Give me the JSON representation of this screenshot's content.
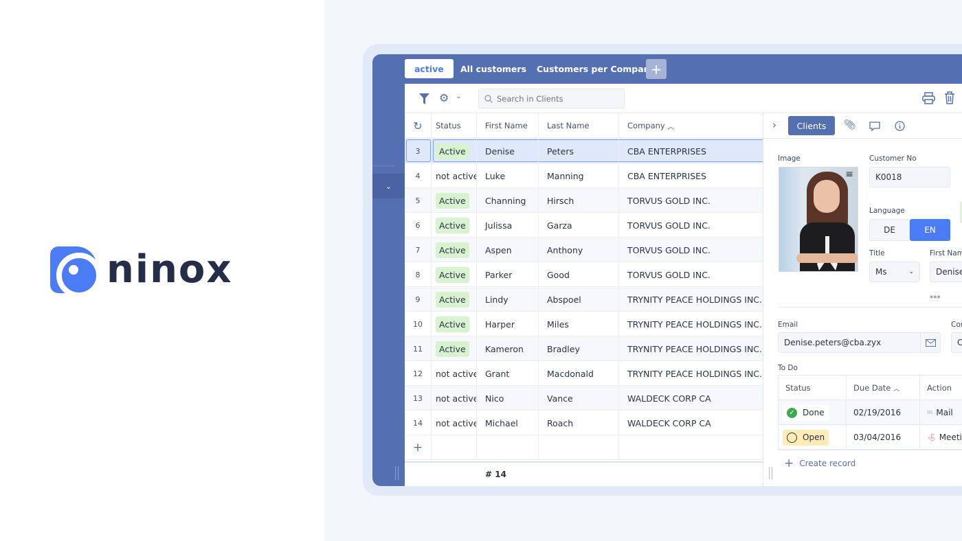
{
  "brand": {
    "name": "ninox",
    "color": "#4b7bf5"
  },
  "tabs": [
    {
      "label": "active",
      "active": true
    },
    {
      "label": "All customers"
    },
    {
      "label": "Customers per Company"
    }
  ],
  "toolbar": {
    "search_placeholder": "Search in Clients"
  },
  "table": {
    "headers": [
      "Status",
      "First Name",
      "Last Name",
      "Company"
    ],
    "sort_indicator": "^",
    "rows": [
      {
        "id": "3",
        "status": "Active",
        "first": "Denise",
        "last": "Peters",
        "company": "CBA ENTERPRISES",
        "selected": true
      },
      {
        "id": "4",
        "status": "not active",
        "first": "Luke",
        "last": "Manning",
        "company": "CBA ENTERPRISES"
      },
      {
        "id": "5",
        "status": "Active",
        "first": "Channing",
        "last": "Hirsch",
        "company": "TORVUS GOLD INC."
      },
      {
        "id": "6",
        "status": "Active",
        "first": "Julissa",
        "last": "Garza",
        "company": "TORVUS GOLD INC."
      },
      {
        "id": "7",
        "status": "Active",
        "first": "Aspen",
        "last": "Anthony",
        "company": "TORVUS GOLD INC."
      },
      {
        "id": "8",
        "status": "Active",
        "first": "Parker",
        "last": "Good",
        "company": "TORVUS GOLD INC."
      },
      {
        "id": "9",
        "status": "Active",
        "first": "Lindy",
        "last": "Abspoel",
        "company": "TRYNITY PEACE HOLDINGS INC."
      },
      {
        "id": "10",
        "status": "Active",
        "first": "Harper",
        "last": "Miles",
        "company": "TRYNITY PEACE HOLDINGS INC."
      },
      {
        "id": "11",
        "status": "Active",
        "first": "Kameron",
        "last": "Bradley",
        "company": "TRYNITY PEACE HOLDINGS INC."
      },
      {
        "id": "12",
        "status": "not active",
        "first": "Grant",
        "last": "Macdonald",
        "company": "TRYNITY PEACE HOLDINGS INC."
      },
      {
        "id": "13",
        "status": "not active",
        "first": "Nico",
        "last": "Vance",
        "company": "WALDECK CORP CA"
      },
      {
        "id": "14",
        "status": "not active",
        "first": "Michael",
        "last": "Roach",
        "company": "WALDECK CORP CA"
      }
    ],
    "footer_count": "# 14"
  },
  "detail": {
    "tab": "Clients",
    "image_label": "Image",
    "customer_no_label": "Customer No",
    "customer_no": "K0018",
    "language_label": "Language",
    "languages": [
      "DE",
      "EN"
    ],
    "language_selected": "EN",
    "title_label": "Title",
    "title": "Ms",
    "first_name_label": "First Nam",
    "first_name": "Denise",
    "stars": "***",
    "email_label": "Email",
    "email": "Denise.peters@cba.zyx",
    "contact_label": "Con",
    "contact": "Cl",
    "todo_label": "To Do",
    "todo_headers": [
      "Status",
      "Due Date",
      "Action"
    ],
    "todo_rows": [
      {
        "status": "Done",
        "date": "02/19/2016",
        "action": "Mail"
      },
      {
        "status": "Open",
        "date": "03/04/2016",
        "action": "Meeti"
      }
    ],
    "create_record": "Create record"
  }
}
